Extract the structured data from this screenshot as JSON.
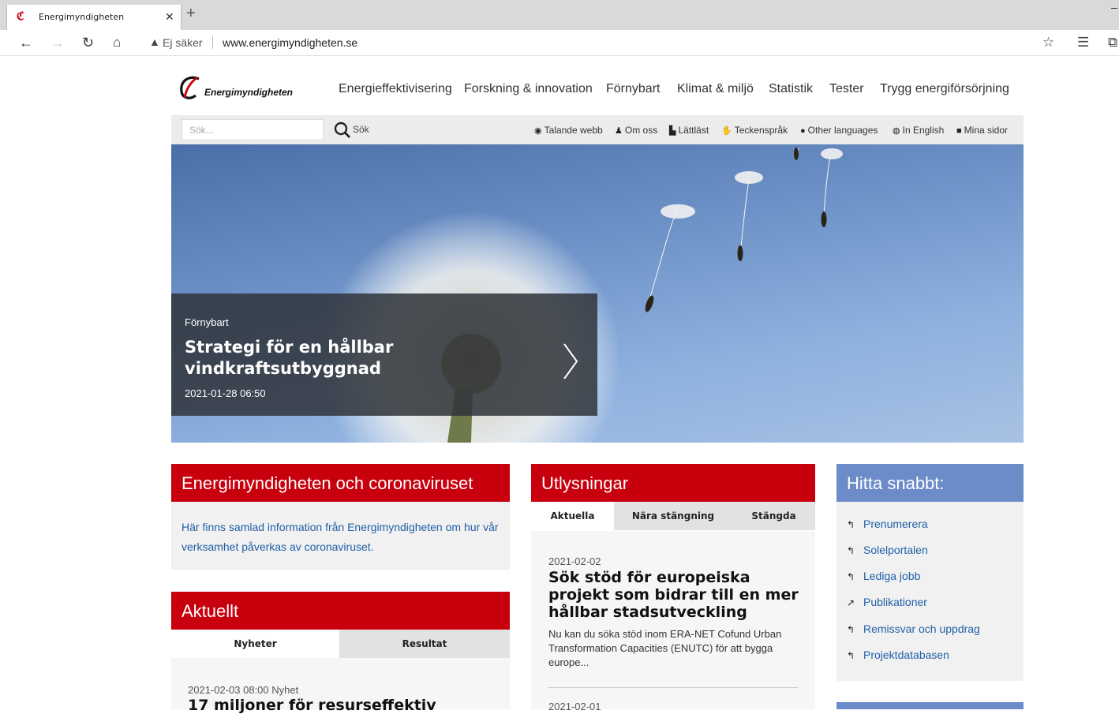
{
  "browser": {
    "tab_title": "Energimyndigheten",
    "security_label": "Ej säker",
    "url": "www.energimyndigheten.se"
  },
  "site": {
    "logo_text": "Energimyndigheten",
    "brand_color": "#c8000d",
    "nav": [
      "Energieffektivisering",
      "Forskning & innovation",
      "Förnybart",
      "Klimat & miljö",
      "Statistik",
      "Tester",
      "Trygg energiförsörjning"
    ],
    "search": {
      "placeholder": "Sök...",
      "button_label": "Sök"
    },
    "util_links": [
      {
        "icon": "speaker-icon",
        "label": "Talande webb"
      },
      {
        "icon": "person-icon",
        "label": "Om oss"
      },
      {
        "icon": "easy-read-icon",
        "label": "Lättläst"
      },
      {
        "icon": "sign-language-icon",
        "label": "Teckenspråk"
      },
      {
        "icon": "speech-bubble-icon",
        "label": "Other languages"
      },
      {
        "icon": "globe-icon",
        "label": "In English"
      },
      {
        "icon": "lock-icon",
        "label": "Mina sidor"
      }
    ]
  },
  "hero": {
    "category": "Förnybart",
    "title": "Strategi för en hållbar vindkraftsutbyggnad",
    "date": "2021-01-28 06:50"
  },
  "corona": {
    "heading": "Energimyndigheten och coronaviruset",
    "text": "Här finns samlad information från Energimyndigheten om hur vår verksamhet påverkas av coronaviruset."
  },
  "aktuellt": {
    "heading": "Aktuellt",
    "tabs": [
      "Nyheter",
      "Resultat"
    ],
    "active_tab": "Nyheter",
    "first_item": {
      "meta": "2021-02-03 08:00 Nyhet",
      "title": "17 miljoner för resurseffektiv"
    }
  },
  "utlysningar": {
    "heading": "Utlysningar",
    "tabs": [
      "Aktuella",
      "Nära stängning",
      "Stängda"
    ],
    "active_tab": "Aktuella",
    "items": [
      {
        "date": "2021-02-02",
        "title": "Sök stöd för europeiska projekt som bidrar till en mer hållbar stadsutveckling",
        "text": "Nu kan du söka stöd inom ERA-NET Cofund Urban Transformation Capacities (ENUTC) för att bygga europe..."
      },
      {
        "date": "2021-02-01"
      }
    ]
  },
  "quick": {
    "heading": "Hitta snabbt:",
    "items": [
      {
        "icon": "subscribe-icon",
        "label": "Prenumerera"
      },
      {
        "icon": "external-link-icon",
        "label": "Solelportalen"
      },
      {
        "icon": "external-link-icon",
        "label": "Lediga jobb"
      },
      {
        "icon": "share-icon",
        "label": "Publikationer"
      },
      {
        "icon": "external-link-icon",
        "label": "Remissvar och uppdrag"
      },
      {
        "icon": "external-link-icon",
        "label": "Projektdatabasen"
      }
    ]
  }
}
